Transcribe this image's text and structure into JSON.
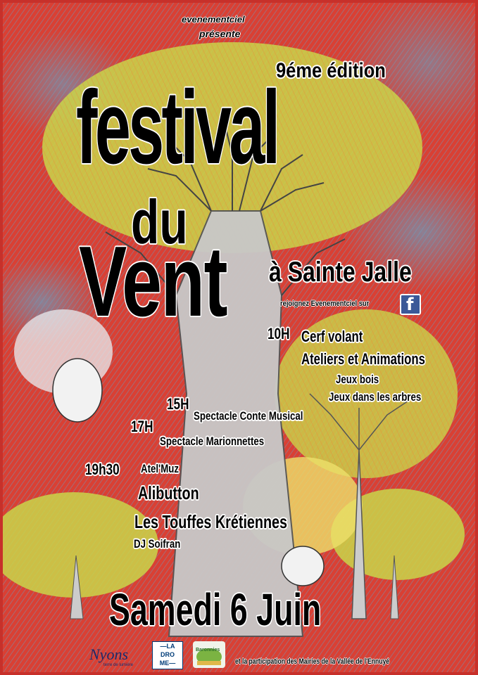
{
  "presenter": {
    "org": "evenementciel",
    "presents": "présente"
  },
  "edition": "9éme édition",
  "title": {
    "line1": "festival",
    "line2": "du",
    "line3": "Vent"
  },
  "location": "à Sainte Jalle",
  "social": {
    "text": "rejoignez Evenementciel sur",
    "icon": "facebook-icon",
    "color": "#3b5998"
  },
  "program": {
    "t10": "10H",
    "cerf": "Cerf volant",
    "ateliers": "Ateliers et Animations",
    "jeux_bois": "Jeux bois",
    "jeux_arbres": "Jeux dans les arbres",
    "t15": "15H",
    "conte": "Spectacle Conte Musical",
    "t17": "17H",
    "marionnettes": "Spectacle Marionnettes",
    "t19": "19h30",
    "atel": "Atel'Muz",
    "alibutton": "Alibutton",
    "touffes": "Les Touffes Krétiennes",
    "dj": "DJ Soifran"
  },
  "date": "Samedi 6 Juin",
  "partners": {
    "text": "et la participation des Mairies de la Vallée de l'Ennuyé",
    "nyons": "Nyons",
    "nyons_tag": "terre de lumière",
    "drome": [
      "—LA",
      "DRO",
      "ME—"
    ],
    "baronnies": "Baronnies"
  },
  "colors": {
    "background": "#d94034",
    "tree_green": "#c9d64a",
    "sky_blue": "#5aaad2"
  }
}
